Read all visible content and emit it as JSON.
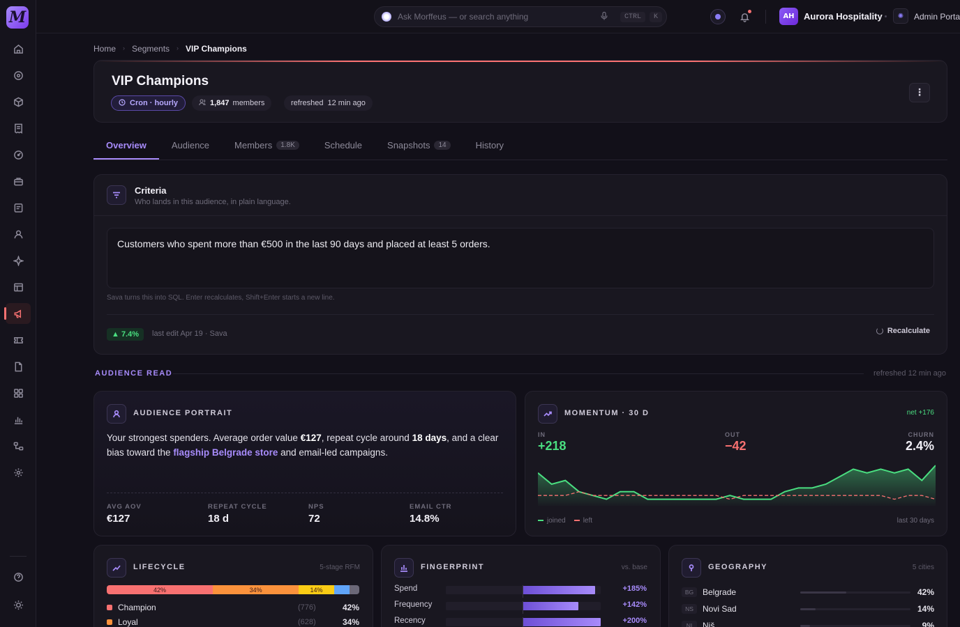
{
  "app": {
    "logo": "M"
  },
  "sidebar": {
    "items": [
      {
        "name": "home-icon"
      },
      {
        "name": "target-icon"
      },
      {
        "name": "cube-icon"
      },
      {
        "name": "receipt-icon"
      },
      {
        "name": "gauge-icon"
      },
      {
        "name": "briefcase-icon"
      },
      {
        "name": "note-icon"
      },
      {
        "name": "user-icon"
      },
      {
        "name": "sparkle-icon"
      },
      {
        "name": "table-icon"
      },
      {
        "name": "megaphone-icon"
      },
      {
        "name": "ticket-icon"
      },
      {
        "name": "document-icon"
      },
      {
        "name": "grid-icon"
      },
      {
        "name": "bar-chart-icon"
      },
      {
        "name": "flow-icon"
      },
      {
        "name": "settings-icon"
      }
    ],
    "active": "megaphone-icon",
    "bottom": [
      {
        "name": "help-icon"
      },
      {
        "name": "theme-icon"
      }
    ]
  },
  "topbar": {
    "search_placeholder": "Ask Morffeus — or search anything",
    "kbd1": "CTRL",
    "kbd2": "K",
    "org_initials": "AH",
    "org_name": "Aurora Hospitality",
    "admin_label": "Admin Portal"
  },
  "breadcrumb": {
    "items": [
      "Home",
      "Segments"
    ],
    "current": "VIP Champions"
  },
  "header": {
    "title": "VIP Champions",
    "cron": "Cron · hourly",
    "members_count": "1,847",
    "members_label": "members",
    "refreshed_label": "refreshed",
    "refreshed_value": "12 min ago",
    "accent": "#f87171"
  },
  "tabs": [
    {
      "label": "Overview",
      "active": true
    },
    {
      "label": "Audience"
    },
    {
      "label": "Members",
      "count": "1.8K"
    },
    {
      "label": "Schedule"
    },
    {
      "label": "Snapshots",
      "count": "14"
    },
    {
      "label": "History"
    }
  ],
  "criteria": {
    "title": "Criteria",
    "subtitle": "Who lands in this audience, in plain language.",
    "text": "Customers who spent more than €500 in the last 90 days and placed at least 5 orders.",
    "hint": "Sava turns this into SQL. Enter recalculates, Shift+Enter starts a new line.",
    "delta": "▲ 7.4%",
    "last_edit": "last edit Apr 19 · Sava",
    "recalc_label": "Recalculate"
  },
  "section": {
    "label": "AUDIENCE READ",
    "refreshed": "refreshed 12 min ago"
  },
  "portrait": {
    "title": "AUDIENCE PORTRAIT",
    "t1": "Your strongest spenders. Average order value ",
    "b1": "€127",
    "t2": ", repeat cycle around ",
    "b2": "18 days",
    "t3": ", and a clear bias toward the ",
    "hl": "flagship Belgrade store",
    "t4": " and email-led campaigns.",
    "stats": [
      {
        "label": "AVG AOV",
        "value": "€127"
      },
      {
        "label": "REPEAT CYCLE",
        "value": "18 d"
      },
      {
        "label": "NPS",
        "value": "72"
      },
      {
        "label": "EMAIL CTR",
        "value": "14.8%"
      }
    ]
  },
  "momentum": {
    "title": "MOMENTUM · 30 D",
    "net": "net +176",
    "in_label": "IN",
    "in_value": "+218",
    "out_label": "OUT",
    "out_value": "−42",
    "churn_label": "CHURN",
    "churn_value": "2.4%",
    "legend_joined": "joined",
    "legend_left": "left",
    "period": "last 30 days",
    "colors": {
      "in": "#4ade80",
      "out": "#f87171"
    },
    "joined": [
      8,
      5,
      6,
      3,
      2,
      1,
      3,
      3,
      1,
      1,
      1,
      1,
      1,
      1,
      2,
      1,
      1,
      1,
      3,
      4,
      4,
      5,
      7,
      9,
      8,
      9,
      8,
      9,
      6,
      10
    ],
    "left": [
      2,
      2,
      2,
      3,
      2,
      2,
      2,
      2,
      2,
      2,
      2,
      2,
      2,
      2,
      1,
      2,
      2,
      2,
      2,
      2,
      2,
      2,
      2,
      2,
      2,
      2,
      1,
      2,
      2,
      1
    ]
  },
  "lifecycle": {
    "title": "LIFECYCLE",
    "meta": "5-stage RFM",
    "stack": [
      {
        "pct": 42,
        "label": "42%",
        "color": "#f87171"
      },
      {
        "pct": 34,
        "label": "34%",
        "color": "#fb923c"
      },
      {
        "pct": 14,
        "label": "14%",
        "color": "#facc15"
      },
      {
        "pct": 6,
        "label": "",
        "color": "#60a5fa"
      },
      {
        "pct": 4,
        "label": "",
        "color": "#6b6878"
      }
    ],
    "rows": [
      {
        "name": "Champion",
        "count": "(776)",
        "pct": "42%",
        "color": "#f87171"
      },
      {
        "name": "Loyal",
        "count": "(628)",
        "pct": "34%",
        "color": "#fb923c"
      }
    ]
  },
  "fingerprint": {
    "title": "FINGERPRINT",
    "meta": "vs. base",
    "rows": [
      {
        "label": "Spend",
        "pct": "+185%",
        "fill": 0.185
      },
      {
        "label": "Frequency",
        "pct": "+142%",
        "fill": 0.142
      },
      {
        "label": "Recency",
        "pct": "+200%",
        "fill": 0.2
      }
    ]
  },
  "geography": {
    "title": "GEOGRAPHY",
    "meta": "5 cities",
    "rows": [
      {
        "code": "BG",
        "name": "Belgrade",
        "pct": "42%",
        "fill": 0.42
      },
      {
        "code": "NS",
        "name": "Novi Sad",
        "pct": "14%",
        "fill": 0.14
      },
      {
        "code": "NI",
        "name": "Niš",
        "pct": "9%",
        "fill": 0.09
      }
    ]
  }
}
